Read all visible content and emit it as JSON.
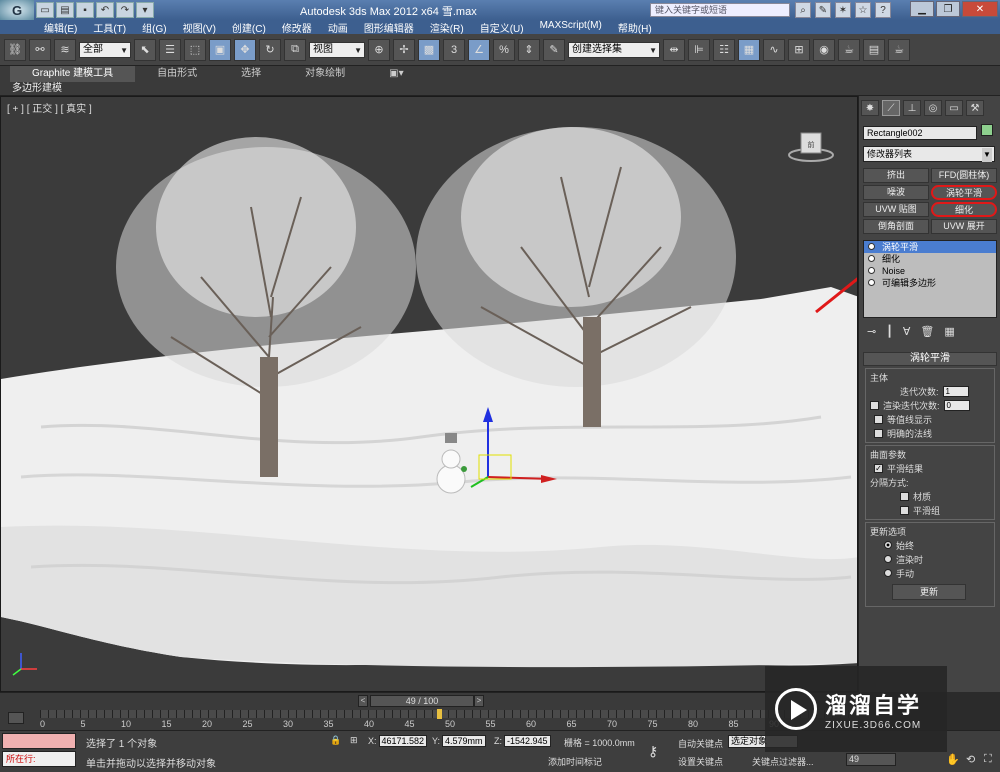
{
  "window": {
    "app_title": "Autodesk 3ds Max  2012 x64      雪.max",
    "search_placeholder": "键入关键字或短语",
    "logo": "G"
  },
  "menu": [
    "编辑(E)",
    "工具(T)",
    "组(G)",
    "视图(V)",
    "创建(C)",
    "修改器",
    "动画",
    "图形编辑器",
    "渲染(R)",
    "自定义(U)",
    "MAXScript(M)",
    "帮助(H)"
  ],
  "toolbar": {
    "selection_filter": "全部",
    "reference_coord": "视图",
    "named_selection": "创建选择集",
    "snap_label": "3",
    "percent_label": "%"
  },
  "ribbon": {
    "tabs": [
      "Graphite 建模工具",
      "自由形式",
      "选择",
      "对象绘制"
    ],
    "active_tab": 0,
    "subpanel": "多边形建模"
  },
  "viewport": {
    "label": "[ + ] [ 正交 ] [ 真实 ]",
    "cube_label": "前"
  },
  "command_panel": {
    "object_name": "Rectangle002",
    "object_color": "#8ed08e",
    "modifier_list": "修改器列表",
    "modifier_buttons": [
      "挤出",
      "FFD(圆柱体)",
      "噪波",
      "涡轮平滑",
      "UVW 贴图",
      "细化",
      "倒角剖面",
      "UVW 展开"
    ],
    "stack": [
      {
        "label": "涡轮平滑",
        "selected": true
      },
      {
        "label": "细化",
        "selected": false
      },
      {
        "label": "Noise",
        "selected": false
      },
      {
        "label": "可编辑多边形",
        "selected": false
      }
    ],
    "rollout_title": "涡轮平滑",
    "main_group": "主体",
    "iterations_label": "迭代次数:",
    "iterations_value": "1",
    "render_iters_label": "渲染迭代次数:",
    "render_iters_value": "0",
    "isoline_label": "等值线显示",
    "explicit_normals_label": "明确的法线",
    "surface_group": "曲面参数",
    "smooth_result_label": "平滑结果",
    "separate_label": "分隔方式:",
    "materials_label": "材质",
    "smoothing_groups_label": "平滑组",
    "update_group": "更新选项",
    "always_label": "始终",
    "when_rendering_label": "渲染时",
    "manually_label": "手动",
    "update_button": "更新"
  },
  "timeline": {
    "frame_display": "49 / 100",
    "current_frame": 49,
    "total_frames": 100,
    "ticks": [
      0,
      5,
      10,
      15,
      20,
      25,
      30,
      35,
      40,
      45,
      50,
      55,
      60,
      65,
      70,
      75,
      80,
      85,
      90
    ]
  },
  "status": {
    "selection_text": "选择了 1 个对象",
    "prompt_text": "单击并拖动以选择并移动对象",
    "now_label": "所在行:",
    "x_label": "X:",
    "x_value": "46171.582",
    "y_label": "Y:",
    "y_value": "4.579mm",
    "z_label": "Z:",
    "z_value": "-1542.945",
    "grid_text": "栅格 = 1000.0mm",
    "add_time_tag": "添加时间标记",
    "auto_key": "自动关键点",
    "auto_key_select": "选定对象",
    "set_key": "设置关键点",
    "key_filters": "关键点过滤器...",
    "frame_value": "49"
  },
  "watermark": {
    "title": "溜溜自学",
    "subtitle": "ZIXUE.3D66.COM"
  },
  "colors": {
    "accent_blue": "#4a7dd0",
    "annotation_red": "#e01818",
    "viewport_bg": "#3b3b3b",
    "snow": "#f2f2f2"
  }
}
